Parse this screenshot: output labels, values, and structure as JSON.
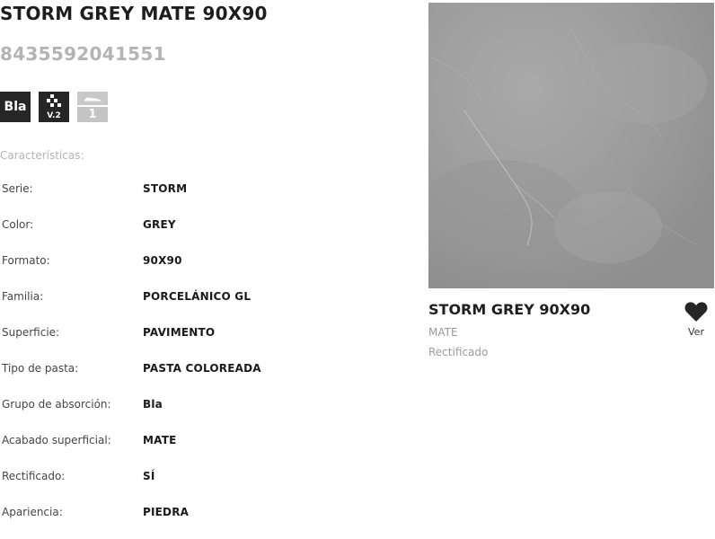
{
  "product": {
    "title": "STORM GREY MATE 90X90",
    "ean": "8435592041551"
  },
  "badges": {
    "absorption": "Bla",
    "variation": "V.2",
    "traffic": "1"
  },
  "characteristics": {
    "label": "Características:",
    "rows": [
      {
        "key": "Serie:",
        "value": "STORM"
      },
      {
        "key": "Color:",
        "value": "GREY"
      },
      {
        "key": "Formato:",
        "value": "90X90"
      },
      {
        "key": "Familia:",
        "value": "PORCELÁNICO GL"
      },
      {
        "key": "Superficie:",
        "value": "PAVIMENTO"
      },
      {
        "key": "Tipo de pasta:",
        "value": "PASTA COLOREADA"
      },
      {
        "key": "Grupo de absorción:",
        "value": "Bla"
      },
      {
        "key": "Acabado superficial:",
        "value": "MATE"
      },
      {
        "key": "Rectificado:",
        "value": "SÍ"
      },
      {
        "key": "Apariencia:",
        "value": "PIEDRA"
      }
    ]
  },
  "card": {
    "name": "STORM GREY 90X90",
    "finish": "MATE",
    "edge": "Rectificado",
    "favorite_label": "Ver",
    "icon": "heart-icon"
  },
  "colors": {
    "dark_badge": "#262626",
    "muted_text": "#b4b4b4",
    "stone_grey": "#9c9c9c"
  }
}
